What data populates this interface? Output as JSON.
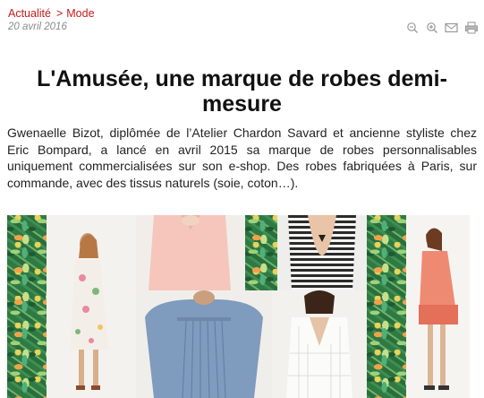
{
  "breadcrumb": {
    "items": [
      {
        "label": "Actualité"
      },
      {
        "separator": ">",
        "label": "Mode"
      }
    ]
  },
  "article": {
    "date": "20 avril 2016",
    "title": "L'Amusée, une marque de robes demi-mesure",
    "lead": "Gwenaelle Bizot, diplômée de l’Atelier Chardon Savard et ancienne styliste chez Eric Bompard, a lancé en avril 2015 sa marque de robes personnalisables uniquement commercialisées sur son e-shop. Des robes fabriquées à Paris, sur commande, avec des tissus naturels (soie, coton…)."
  },
  "tools": [
    {
      "icon": "zoom-out-icon"
    },
    {
      "icon": "zoom-in-icon"
    },
    {
      "icon": "email-icon"
    },
    {
      "icon": "print-icon"
    }
  ],
  "colors": {
    "breadcrumb": "#c81a1a",
    "date": "#8a8a8a",
    "icon": "#9a9a9a",
    "jungle_green": "#2f7a43",
    "studio_bg": "#f3f1ee"
  }
}
